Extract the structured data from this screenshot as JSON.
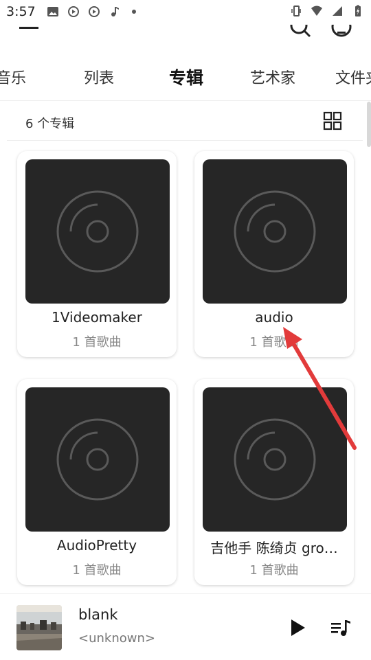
{
  "status_bar": {
    "time": "3:57",
    "left_icons": [
      "image-icon",
      "sync-icon",
      "sync-icon",
      "music-note-icon",
      "dot-icon"
    ],
    "right_icons": [
      "vibrate-icon",
      "wifi-icon",
      "signal-icon",
      "battery-charging-icon"
    ]
  },
  "toolbar": {
    "icons": [
      "menu-icon",
      "search-icon",
      "more-icon"
    ]
  },
  "tabs": [
    {
      "label": "音乐"
    },
    {
      "label": "列表"
    },
    {
      "label": "专辑",
      "active": true
    },
    {
      "label": "艺术家"
    },
    {
      "label": "文件夹"
    }
  ],
  "header": {
    "count_label": "6 个专辑",
    "view_icon": "grid-icon"
  },
  "albums": [
    {
      "title": "1Videomaker",
      "subtitle": "1 首歌曲"
    },
    {
      "title": "audio",
      "subtitle": "1 首歌曲"
    },
    {
      "title": "AudioPretty",
      "subtitle": "1 首歌曲"
    },
    {
      "title": "吉他手 陈绮贞 gro…",
      "subtitle": "1 首歌曲"
    }
  ],
  "player": {
    "title": "blank",
    "artist": "<unknown>"
  },
  "colors": {
    "cover_bg": "#262626",
    "annotation_arrow": "#e23b3b"
  }
}
